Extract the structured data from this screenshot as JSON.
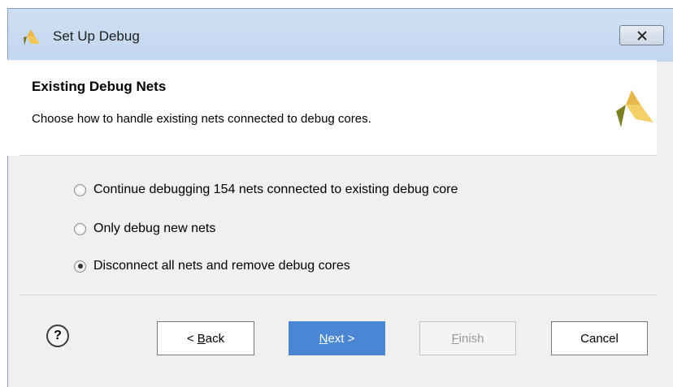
{
  "window": {
    "title": "Set Up Debug",
    "close_icon": "close-x-icon"
  },
  "header": {
    "title": "Existing Debug Nets",
    "description": "Choose how to handle existing nets connected to debug cores.",
    "logo": "vivado-logo"
  },
  "options": [
    {
      "label": "Continue debugging 154 nets connected to existing debug core",
      "selected": false
    },
    {
      "label": "Only debug new nets",
      "selected": false
    },
    {
      "label": "Disconnect all nets and remove debug cores",
      "selected": true
    }
  ],
  "footer": {
    "help_label": "?",
    "back": {
      "prefix": "< ",
      "mnemonic": "B",
      "rest": "ack"
    },
    "next": {
      "mnemonic": "N",
      "rest": "ext >"
    },
    "finish": {
      "mnemonic": "F",
      "rest": "inish",
      "enabled": false
    },
    "cancel": "Cancel"
  },
  "colors": {
    "titlebar": "#c2d6ef",
    "primary_button": "#4a86d4",
    "logo_light": "#e8b84a",
    "logo_dark": "#8a8f2a"
  }
}
